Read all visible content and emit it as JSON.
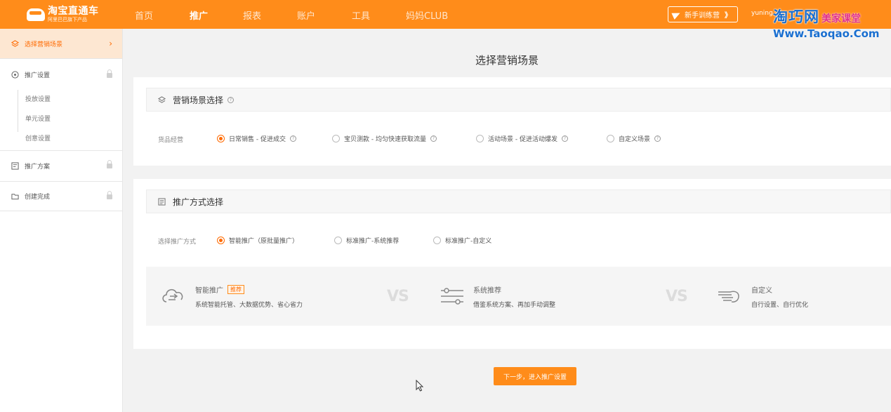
{
  "header": {
    "logo_title": "淘宝直通车",
    "logo_subtitle": "阿里巴巴旗下产品",
    "nav": [
      "首页",
      "推广",
      "报表",
      "账户",
      "工具",
      "妈妈CLUB"
    ],
    "active_nav": "推广",
    "newbie_label": "新手训练营",
    "newbie_paren": "》",
    "user": "yuning"
  },
  "watermark": {
    "brand": "淘巧网",
    "tag": "美家课堂",
    "url": "Www.Taoqao.Com"
  },
  "sidebar": {
    "items": [
      {
        "label": "选择营销场景",
        "active": true
      },
      {
        "label": "推广设置",
        "locked": true
      },
      {
        "label": "推广方案",
        "locked": true
      },
      {
        "label": "创建完成",
        "locked": true
      }
    ],
    "sub_items": [
      "投放设置",
      "单元设置",
      "创意设置"
    ]
  },
  "page_title": "选择营销场景",
  "scene": {
    "heading": "营销场景选择",
    "row_label": "货品经营",
    "options": [
      {
        "label": "日常销售 - 促进成交",
        "checked": true
      },
      {
        "label": "宝贝测款 - 均匀快速获取流量",
        "checked": false
      },
      {
        "label": "活动场景 - 促进活动爆发",
        "checked": false
      },
      {
        "label": "自定义场景",
        "checked": false
      }
    ]
  },
  "method": {
    "heading": "推广方式选择",
    "row_label": "选择推广方式",
    "options": [
      {
        "label": "智能推广（原批量推广）",
        "checked": true
      },
      {
        "label": "标准推广-系统推荐",
        "checked": false
      },
      {
        "label": "标准推广-自定义",
        "checked": false
      }
    ],
    "compare": [
      {
        "title": "智能推广",
        "badge": "推荐",
        "desc": "系统智能托管、大数据优势、省心省力",
        "icon": "cloud-flow-icon"
      },
      {
        "title": "系统推荐",
        "desc": "借鉴系统方案、再加手动调整",
        "icon": "sliders-icon"
      },
      {
        "title": "自定义",
        "desc": "自行设置、自行优化",
        "icon": "hand-pointer-icon"
      }
    ],
    "vs_label": "VS"
  },
  "next_button": "下一步，进入推广设置",
  "colors": {
    "brand": "#ff8c1a",
    "accent": "#ff6a00"
  }
}
